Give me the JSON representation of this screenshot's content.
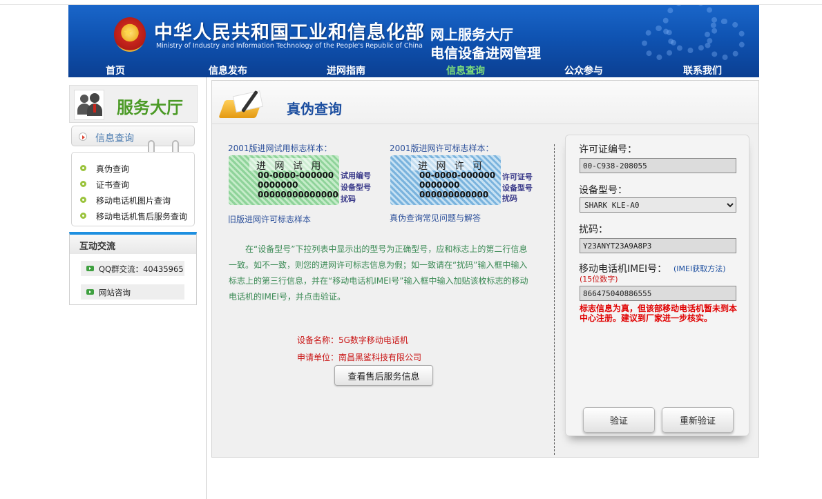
{
  "header": {
    "ministry_cn": "中华人民共和国工业和信息化部",
    "ministry_en": "Ministry of Industry and Information Technology of the People's Republic of China",
    "hall_line1": "网上服务大厅",
    "hall_line2": "电信设备进网管理",
    "nav": [
      {
        "label": "首页"
      },
      {
        "label": "信息发布"
      },
      {
        "label": "进网指南"
      },
      {
        "label": "信息查询"
      },
      {
        "label": "公众参与"
      },
      {
        "label": "联系我们"
      }
    ],
    "active_nav": "信息查询",
    "colors": {
      "header_blue": "#0f53b2",
      "nav_active": "#7fe07a"
    }
  },
  "sidebar": {
    "hall_title": "服务大厅",
    "info_query": "信息查询",
    "items": [
      {
        "label": "真伪查询"
      },
      {
        "label": "证书查询"
      },
      {
        "label": "移动电话机图片查询"
      },
      {
        "label": "移动电话机售后服务查询"
      }
    ],
    "interact_title": "互动交流",
    "qq_group": "QQ群交流：40435965",
    "site_consult": "网站咨询"
  },
  "main": {
    "title": "真伪查询",
    "sample_trial_label": "2001版进网试用标志样本：",
    "sample_permit_label": "2001版进网许可标志样本：",
    "trial_sample": {
      "header": "进 网 试 用",
      "line1": "00-0000-000000",
      "line2": "0000000",
      "line3": "0000000000000000",
      "legend": [
        "试用编号",
        "设备型号",
        "扰码"
      ]
    },
    "permit_sample": {
      "header": "进 网 许 可",
      "line1": "00-0000-000000",
      "line2": "0000000",
      "line3": "000000000000",
      "legend": [
        "许可证号",
        "设备型号",
        "扰码"
      ]
    },
    "old_sample_link": "旧版进网许可标志样本",
    "faq_link": "真伪查询常见问题与解答",
    "instructions": "在“设备型号”下拉列表中显示出的型号为正确型号，应和标志上的第二行信息一致。如不一致，则您的进网许可标志信息为假；如一致请在“扰码”输入框中输入标志上的第三行信息，并在“移动电话机IMEI号”输入框中输入加贴该枚标志的移动电话机的IMEI号，并点击验证。",
    "device_name": "设备名称：5G数字移动电话机",
    "applicant": "申请单位：南昌黑鲨科技有限公司",
    "service_button": "查看售后服务信息"
  },
  "form": {
    "license_label": "许可证编号：",
    "license_value": "00-C938-208055",
    "model_label": "设备型号：",
    "model_value": "SHARK KLE-A0",
    "scramble_label": "扰码：",
    "scramble_value": "Y23ANYT23A9A8P3",
    "imei_label": "移动电话机IMEI号：",
    "imei_hint": "(IMEI获取方法)",
    "imei_sub": "(15位数字)",
    "imei_value": "866475040886555",
    "warning": "标志信息为真，但该部移动电话机暂未到本中心注册。建议到厂家进一步核实。",
    "verify_button": "验证",
    "reverify_button": "重新验证"
  }
}
